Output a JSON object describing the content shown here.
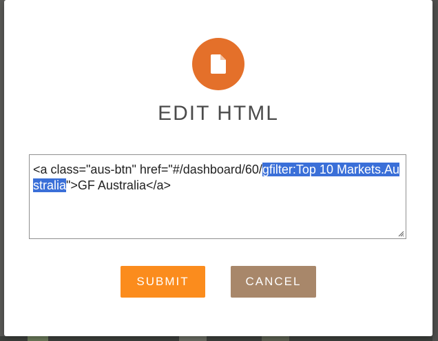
{
  "modal": {
    "icon": "document-icon",
    "title": "EDIT HTML",
    "editor": {
      "text_before": "<a class=\"aus-btn\" href=\"#/dashboard/60/",
      "text_selected": "gfilter:Top 10 Markets.Australia",
      "text_after": "\">GF Australia</a>"
    },
    "submit_label": "SUBMIT",
    "cancel_label": "CANCEL"
  },
  "colors": {
    "icon_circle": "#e4702a",
    "submit": "#fb8c1d",
    "cancel": "#a8876a",
    "selection": "#3a6fd8"
  }
}
